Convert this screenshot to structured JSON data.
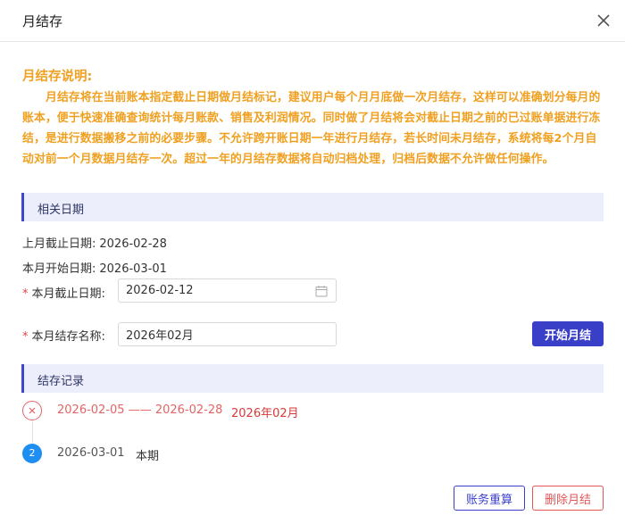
{
  "dialog": {
    "title": "月结存",
    "close_icon": "close-icon"
  },
  "notice": {
    "title": "月结存说明:",
    "body": "月结存将在当前账本指定截止日期做月结标记，建议用户每个月月底做一次月结存，这样可以准确划分每月的账本，便于快速准确查询统计每月账款、销售及利润情况。同时做了月结将会对截止日期之前的已过账单据进行冻结，是进行数据搬移之前的必要步骤。不允许跨开账日期一年进行月结存，若长时间未月结存，系统将每2个月自动对前一个月数据月结存一次。超过一年的月结存数据将自动归档处理，归档后数据不允许做任何操作。",
    "color": "#f0a020"
  },
  "dates_section": {
    "title": "相关日期",
    "last_month_end_label": "上月截止日期:",
    "last_month_end_value": "2026-02-28",
    "this_month_start_label": "本月开始日期:",
    "this_month_start_value": "2026-03-01",
    "this_month_end_label": "本月截止日期:",
    "this_month_end_value": "2026-02-12",
    "name_label": "本月结存名称:",
    "name_value": "2026年02月",
    "required_mark": "*",
    "start_button": "开始月结"
  },
  "records_section": {
    "title": "结存记录",
    "items": [
      {
        "range": "2026-02-05 —— 2026-02-28",
        "name": "2026年02月",
        "status_icon": "x-circle-icon",
        "color": "#e46565"
      },
      {
        "index": "2",
        "date": "2026-03-01",
        "name": "本期",
        "color": "#1f8ef1"
      }
    ]
  },
  "footer": {
    "reset_button": "账务重算",
    "delete_button": "删除月结"
  },
  "colors": {
    "primary": "#3a3fc8",
    "danger": "#e25656",
    "section_bg": "#edeefc"
  }
}
